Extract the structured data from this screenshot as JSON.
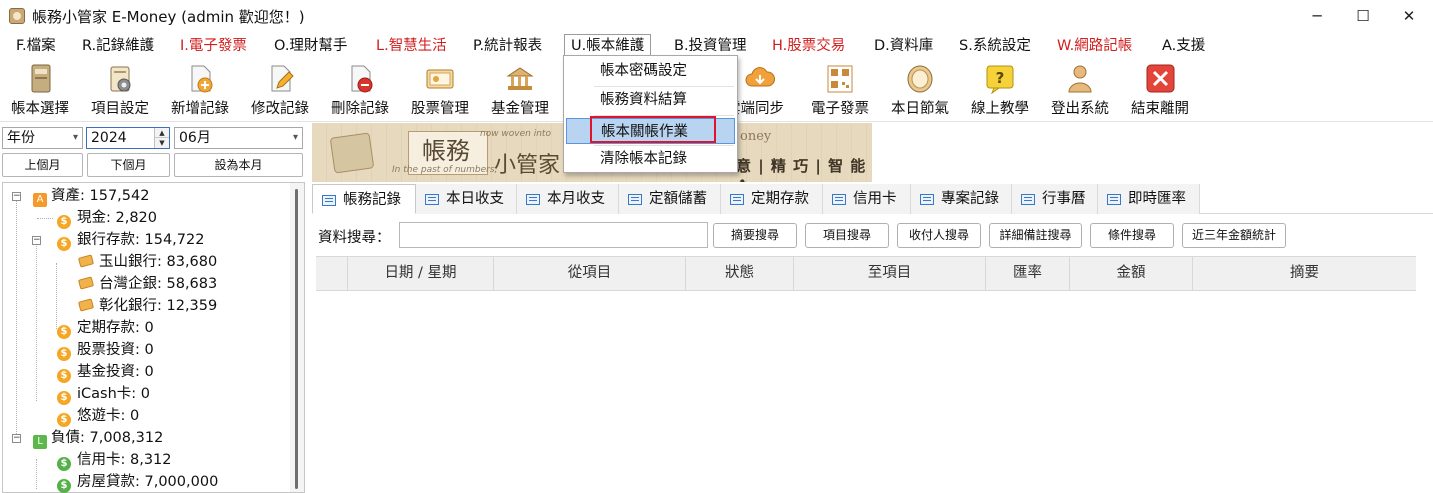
{
  "window": {
    "title": "帳務小管家 E-Money (admin 歡迎您！)",
    "minimize": "─",
    "maximize": "☐",
    "close": "✕"
  },
  "menu": [
    {
      "label": "F.檔案",
      "color": "normal"
    },
    {
      "label": "R.記錄維護",
      "color": "normal"
    },
    {
      "label": "I.電子發票",
      "color": "red"
    },
    {
      "label": "O.理財幫手",
      "color": "normal"
    },
    {
      "label": "L.智慧生活",
      "color": "red"
    },
    {
      "label": "P.統計報表",
      "color": "normal"
    },
    {
      "label": "U.帳本維護",
      "color": "normal",
      "open": true
    },
    {
      "label": "B.投資管理",
      "color": "normal"
    },
    {
      "label": "H.股票交易",
      "color": "red"
    },
    {
      "label": "D.資料庫",
      "color": "normal"
    },
    {
      "label": "S.系統設定",
      "color": "normal"
    },
    {
      "label": "W.網路記帳",
      "color": "red"
    },
    {
      "label": "A.支援",
      "color": "normal"
    }
  ],
  "dropdown": {
    "items": [
      "帳本密碼設定",
      "帳務資料結算",
      "帳本關帳作業",
      "清除帳本記錄"
    ],
    "highlighted_index": 2
  },
  "toolbar": [
    {
      "label": "帳本選擇",
      "icon": "ledger-book-icon"
    },
    {
      "label": "項目設定",
      "icon": "item-settings-icon"
    },
    {
      "label": "新增記錄",
      "icon": "add-record-icon"
    },
    {
      "label": "修改記錄",
      "icon": "edit-record-icon"
    },
    {
      "label": "刪除記錄",
      "icon": "delete-record-icon"
    },
    {
      "label": "股票管理",
      "icon": "stock-icon"
    },
    {
      "label": "基金管理",
      "icon": "fund-icon"
    },
    {
      "label": "雲端同步",
      "icon": "cloud-sync-icon"
    },
    {
      "label": "電子發票",
      "icon": "qr-code-icon"
    },
    {
      "label": "本日節氣",
      "icon": "solar-term-icon"
    },
    {
      "label": "線上教學",
      "icon": "help-icon"
    },
    {
      "label": "登出系統",
      "icon": "logout-user-icon"
    },
    {
      "label": "結束離開",
      "icon": "exit-icon"
    }
  ],
  "filters": {
    "period_type": "年份",
    "year": "2024",
    "month": "06月",
    "prev_month": "上個月",
    "next_month": "下個月",
    "set_this_month": "設為本月"
  },
  "tree": [
    {
      "label": "資產: 157,542",
      "level": 0,
      "icon": "asset-badge",
      "expander": "−"
    },
    {
      "label": "現金: 2,820",
      "level": 1,
      "icon": "coin-orange"
    },
    {
      "label": "銀行存款: 154,722",
      "level": 1,
      "icon": "coin-orange",
      "expander": "−"
    },
    {
      "label": "玉山銀行: 83,680",
      "level": 2,
      "icon": "card"
    },
    {
      "label": "台灣企銀: 58,683",
      "level": 2,
      "icon": "card"
    },
    {
      "label": "彰化銀行: 12,359",
      "level": 2,
      "icon": "card"
    },
    {
      "label": "定期存款: 0",
      "level": 1,
      "icon": "coin-orange"
    },
    {
      "label": "股票投資: 0",
      "level": 1,
      "icon": "coin-orange"
    },
    {
      "label": "基金投資: 0",
      "level": 1,
      "icon": "coin-orange"
    },
    {
      "label": "iCash卡: 0",
      "level": 1,
      "icon": "coin-orange"
    },
    {
      "label": "悠遊卡: 0",
      "level": 1,
      "icon": "coin-orange"
    },
    {
      "label": "負債: 7,008,312",
      "level": 0,
      "icon": "liability-badge",
      "expander": "−"
    },
    {
      "label": "信用卡: 8,312",
      "level": 1,
      "icon": "coin-green"
    },
    {
      "label": "房屋貸款: 7,000,000",
      "level": 1,
      "icon": "coin-green"
    }
  ],
  "banner": {
    "logo_main": "帳務",
    "logo_sub": "小管家",
    "money_text": "oney",
    "tagline_en": "In the past of numbers,",
    "tagline_en2": "now woven into",
    "slogan": "意 | 精 巧 | 智 能 ✿"
  },
  "tabs": [
    "帳務記錄",
    "本日收支",
    "本月收支",
    "定額儲蓄",
    "定期存款",
    "信用卡",
    "專案記錄",
    "行事曆",
    "即時匯率"
  ],
  "search": {
    "label": "資料搜尋：",
    "value": "",
    "buttons": [
      "摘要搜尋",
      "項目搜尋",
      "收付人搜尋",
      "詳細備註搜尋",
      "條件搜尋",
      "近三年金額統計"
    ]
  },
  "grid": {
    "columns": [
      "",
      "日期 / 星期",
      "從項目",
      "狀態",
      "至項目",
      "匯率",
      "金額",
      "摘要"
    ]
  },
  "colors": {
    "menu_red": "#d21e1e",
    "highlight_blue": "#b9d4f1",
    "annotation_red": "#e0142a"
  }
}
